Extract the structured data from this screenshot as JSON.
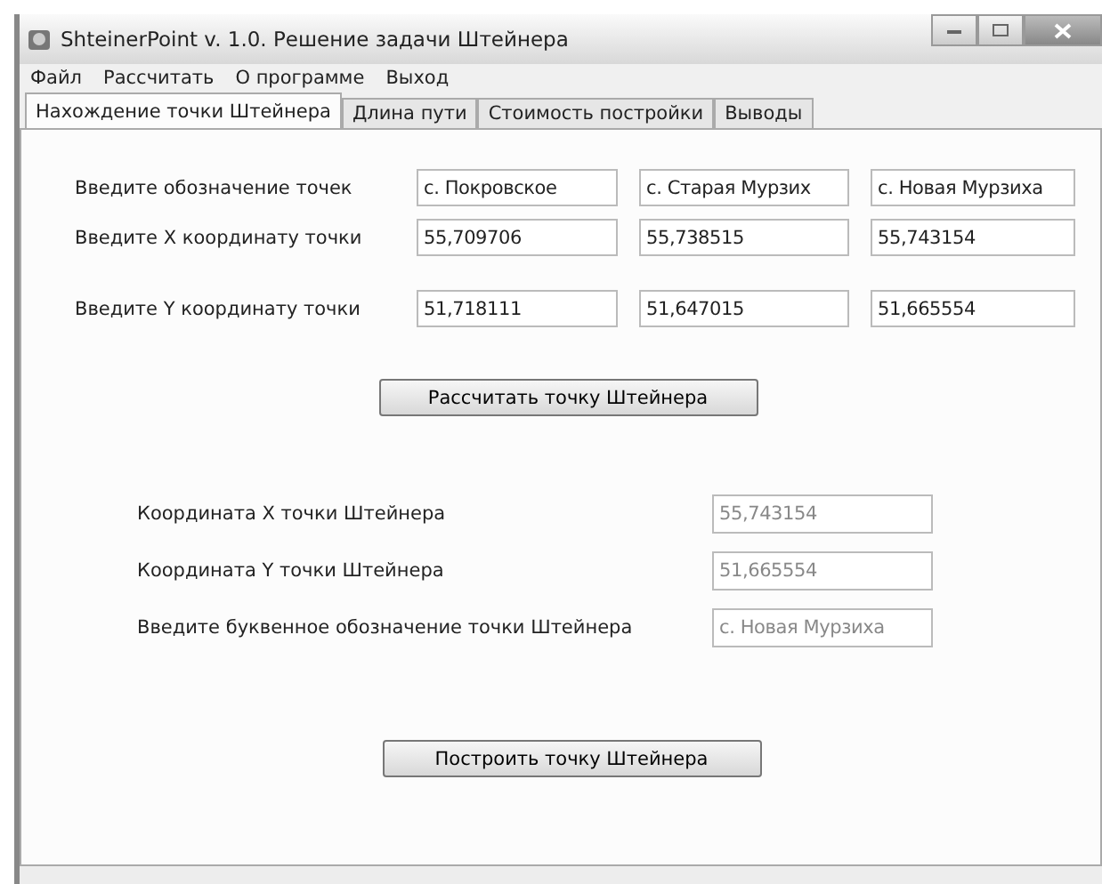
{
  "window": {
    "title": "ShteinerPoint v. 1.0. Решение задачи Штейнера"
  },
  "menu": [
    "Файл",
    "Рассчитать",
    "О программе",
    "Выход"
  ],
  "tabs": [
    {
      "label": "Нахождение точки Штейнера",
      "selected": true
    },
    {
      "label": "Длина пути",
      "selected": false
    },
    {
      "label": "Стоимость постройки",
      "selected": false
    },
    {
      "label": "Выводы",
      "selected": false
    }
  ],
  "input_rows": [
    {
      "label": "Введите обозначение точек",
      "values": [
        "с. Покровское",
        "с. Старая Мурзих",
        "с. Новая Мурзиха"
      ]
    },
    {
      "label": "Введите X координату точки",
      "values": [
        "55,709706",
        "55,738515",
        "55,743154"
      ]
    },
    {
      "label": "Введите Y координату точки",
      "values": [
        "51,718111",
        "51,647015",
        "51,665554"
      ]
    }
  ],
  "calculate_button": "Рассчитать точку Штейнера",
  "result_rows": [
    {
      "label": "Координата X точки Штейнера",
      "value": "55,743154",
      "disabled": true
    },
    {
      "label": "Координата Y точки Штейнера",
      "value": "51,665554",
      "disabled": true
    },
    {
      "label": "Введите буквенное обозначение точки Штейнера",
      "value": "с. Новая Мурзиха",
      "disabled": true
    }
  ],
  "build_button": "Построить точку Штейнера"
}
